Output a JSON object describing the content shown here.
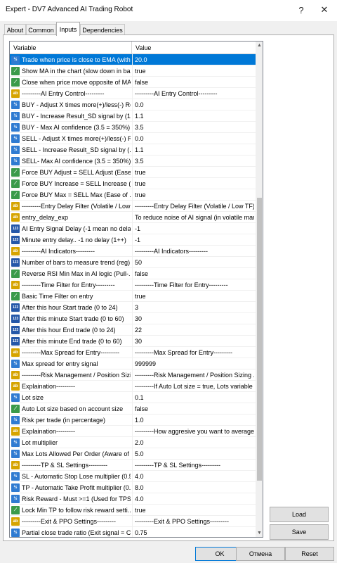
{
  "window": {
    "title": "Expert - DV7 Advanced AI Trading Robot",
    "help_glyph": "?",
    "close_glyph": "✕"
  },
  "tabs": [
    {
      "label": "About"
    },
    {
      "label": "Common"
    },
    {
      "label": "Inputs"
    },
    {
      "label": "Dependencies"
    }
  ],
  "grid": {
    "headers": {
      "variable": "Variable",
      "value": "Value"
    },
    "rows": [
      {
        "icon": "va",
        "variable": "Trade when price is close to EMA (with...",
        "value": "20.0",
        "selected": true
      },
      {
        "icon": "ln",
        "variable": "Show MA in the chart (slow down in ba...",
        "value": "true"
      },
      {
        "icon": "ln",
        "variable": "Close when price move opposite of MA",
        "value": "false"
      },
      {
        "icon": "ab",
        "variable": "---------AI Entry Control---------",
        "value": "---------AI Entry Control---------"
      },
      {
        "icon": "va",
        "variable": "BUY - Adjust X times more(+)/less(-) Re...",
        "value": "0.0"
      },
      {
        "icon": "va",
        "variable": "BUY - Increase Result_SD signal by (1...",
        "value": "1.1"
      },
      {
        "icon": "va",
        "variable": "BUY - Max AI confidence (3.5 = 350%)",
        "value": "3.5"
      },
      {
        "icon": "va",
        "variable": "SELL - Adjust X times more(+)/less(-) R...",
        "value": "0.0"
      },
      {
        "icon": "va",
        "variable": "SELL - Increase Result_SD signal by (...",
        "value": "1.1"
      },
      {
        "icon": "va",
        "variable": "SELL- Max AI confidence (3.5 = 350%)",
        "value": "3.5"
      },
      {
        "icon": "ln",
        "variable": "Force BUY Adjust = SELL Adjust (Ease...",
        "value": "true"
      },
      {
        "icon": "ln",
        "variable": "Force BUY Increase = SELL Increase (...",
        "value": "true"
      },
      {
        "icon": "ln",
        "variable": "Force BUY Max = SELL Max (Ease of ...",
        "value": "true"
      },
      {
        "icon": "ab",
        "variable": "---------Entry Delay Filter (Volatile / Low ...",
        "value": "---------Entry Delay Filter (Volatile / Low TF)-..."
      },
      {
        "icon": "ab",
        "variable": "entry_delay_exp",
        "value": "To reduce noise of AI signal (in volatile mar..."
      },
      {
        "icon": "num",
        "variable": "AI Entry Signal Delay (-1 mean no dela...",
        "value": "-1"
      },
      {
        "icon": "num",
        "variable": "Minute entry delay.. -1 no delay (1++)",
        "value": "-1"
      },
      {
        "icon": "ab",
        "variable": "---------AI Indicators---------",
        "value": "---------AI Indicators---------"
      },
      {
        "icon": "num",
        "variable": "Number of bars to measure trend (reg) (...",
        "value": "50"
      },
      {
        "icon": "ln",
        "variable": "Reverse RSI Min Max in AI logic (Pull-...",
        "value": "false"
      },
      {
        "icon": "ab",
        "variable": "---------Time Filter for Entry---------",
        "value": "---------Time Filter for Entry---------"
      },
      {
        "icon": "ln",
        "variable": "Basic Time Filter on entry",
        "value": "true"
      },
      {
        "icon": "num",
        "variable": "After this hour Start trade (0 to 24)",
        "value": "3"
      },
      {
        "icon": "num",
        "variable": "After this minute Start trade (0 to 60)",
        "value": "30"
      },
      {
        "icon": "num",
        "variable": "After this hour End trade (0 to 24)",
        "value": "22"
      },
      {
        "icon": "num",
        "variable": "After this minute End trade (0 to 60)",
        "value": "30"
      },
      {
        "icon": "ab",
        "variable": "---------Max Spread for Entry---------",
        "value": "---------Max Spread for Entry---------"
      },
      {
        "icon": "va",
        "variable": "Max spread for entry signal",
        "value": "999999"
      },
      {
        "icon": "ab",
        "variable": "---------Risk Management / Position Sizi...",
        "value": "---------Risk Management / Position Sizing ..."
      },
      {
        "icon": "ab",
        "variable": "Explaination---------",
        "value": "---------If Auto Lot size = true, Lots variable ..."
      },
      {
        "icon": "va",
        "variable": "Lot size",
        "value": "0.1"
      },
      {
        "icon": "ln",
        "variable": "Auto Lot size based on account size",
        "value": "false"
      },
      {
        "icon": "va",
        "variable": "Risk per trade (in percentage)",
        "value": "1.0"
      },
      {
        "icon": "ab",
        "variable": "Explaination---------",
        "value": "---------How aggresive you want to average..."
      },
      {
        "icon": "va",
        "variable": "Lot multiplier",
        "value": "2.0"
      },
      {
        "icon": "va",
        "variable": "Max Lots Allowed Per Order (Aware of ...",
        "value": "5.0"
      },
      {
        "icon": "ab",
        "variable": "---------TP & SL Settings---------",
        "value": "---------TP & SL Settings---------"
      },
      {
        "icon": "va",
        "variable": "SL - Automatic Stop Lose multiplier (0.5...",
        "value": "4.0"
      },
      {
        "icon": "va",
        "variable": "TP - Automatic Take Profit multiplier (0....",
        "value": "8.0"
      },
      {
        "icon": "va",
        "variable": "Risk Reward - Must >=1 (Used for TPS...",
        "value": "4.0"
      },
      {
        "icon": "ln",
        "variable": "Lock Min TP to follow risk reward setti...",
        "value": "true"
      },
      {
        "icon": "ab",
        "variable": "---------Exit & PPO Settings---------",
        "value": "---------Exit & PPO Settings---------"
      },
      {
        "icon": "va",
        "variable": "Partial close trade ratio (Exit signal = Cl...",
        "value": "0.75"
      }
    ]
  },
  "buttons": {
    "load": "Load",
    "save": "Save",
    "ok": "OK",
    "cancel": "Отмена",
    "reset": "Reset"
  },
  "scroll": {
    "up": "▲",
    "down": "▼"
  },
  "icon_labels": {
    "va": "½",
    "ln": "⟋",
    "ab": "ab",
    "num": "123"
  }
}
